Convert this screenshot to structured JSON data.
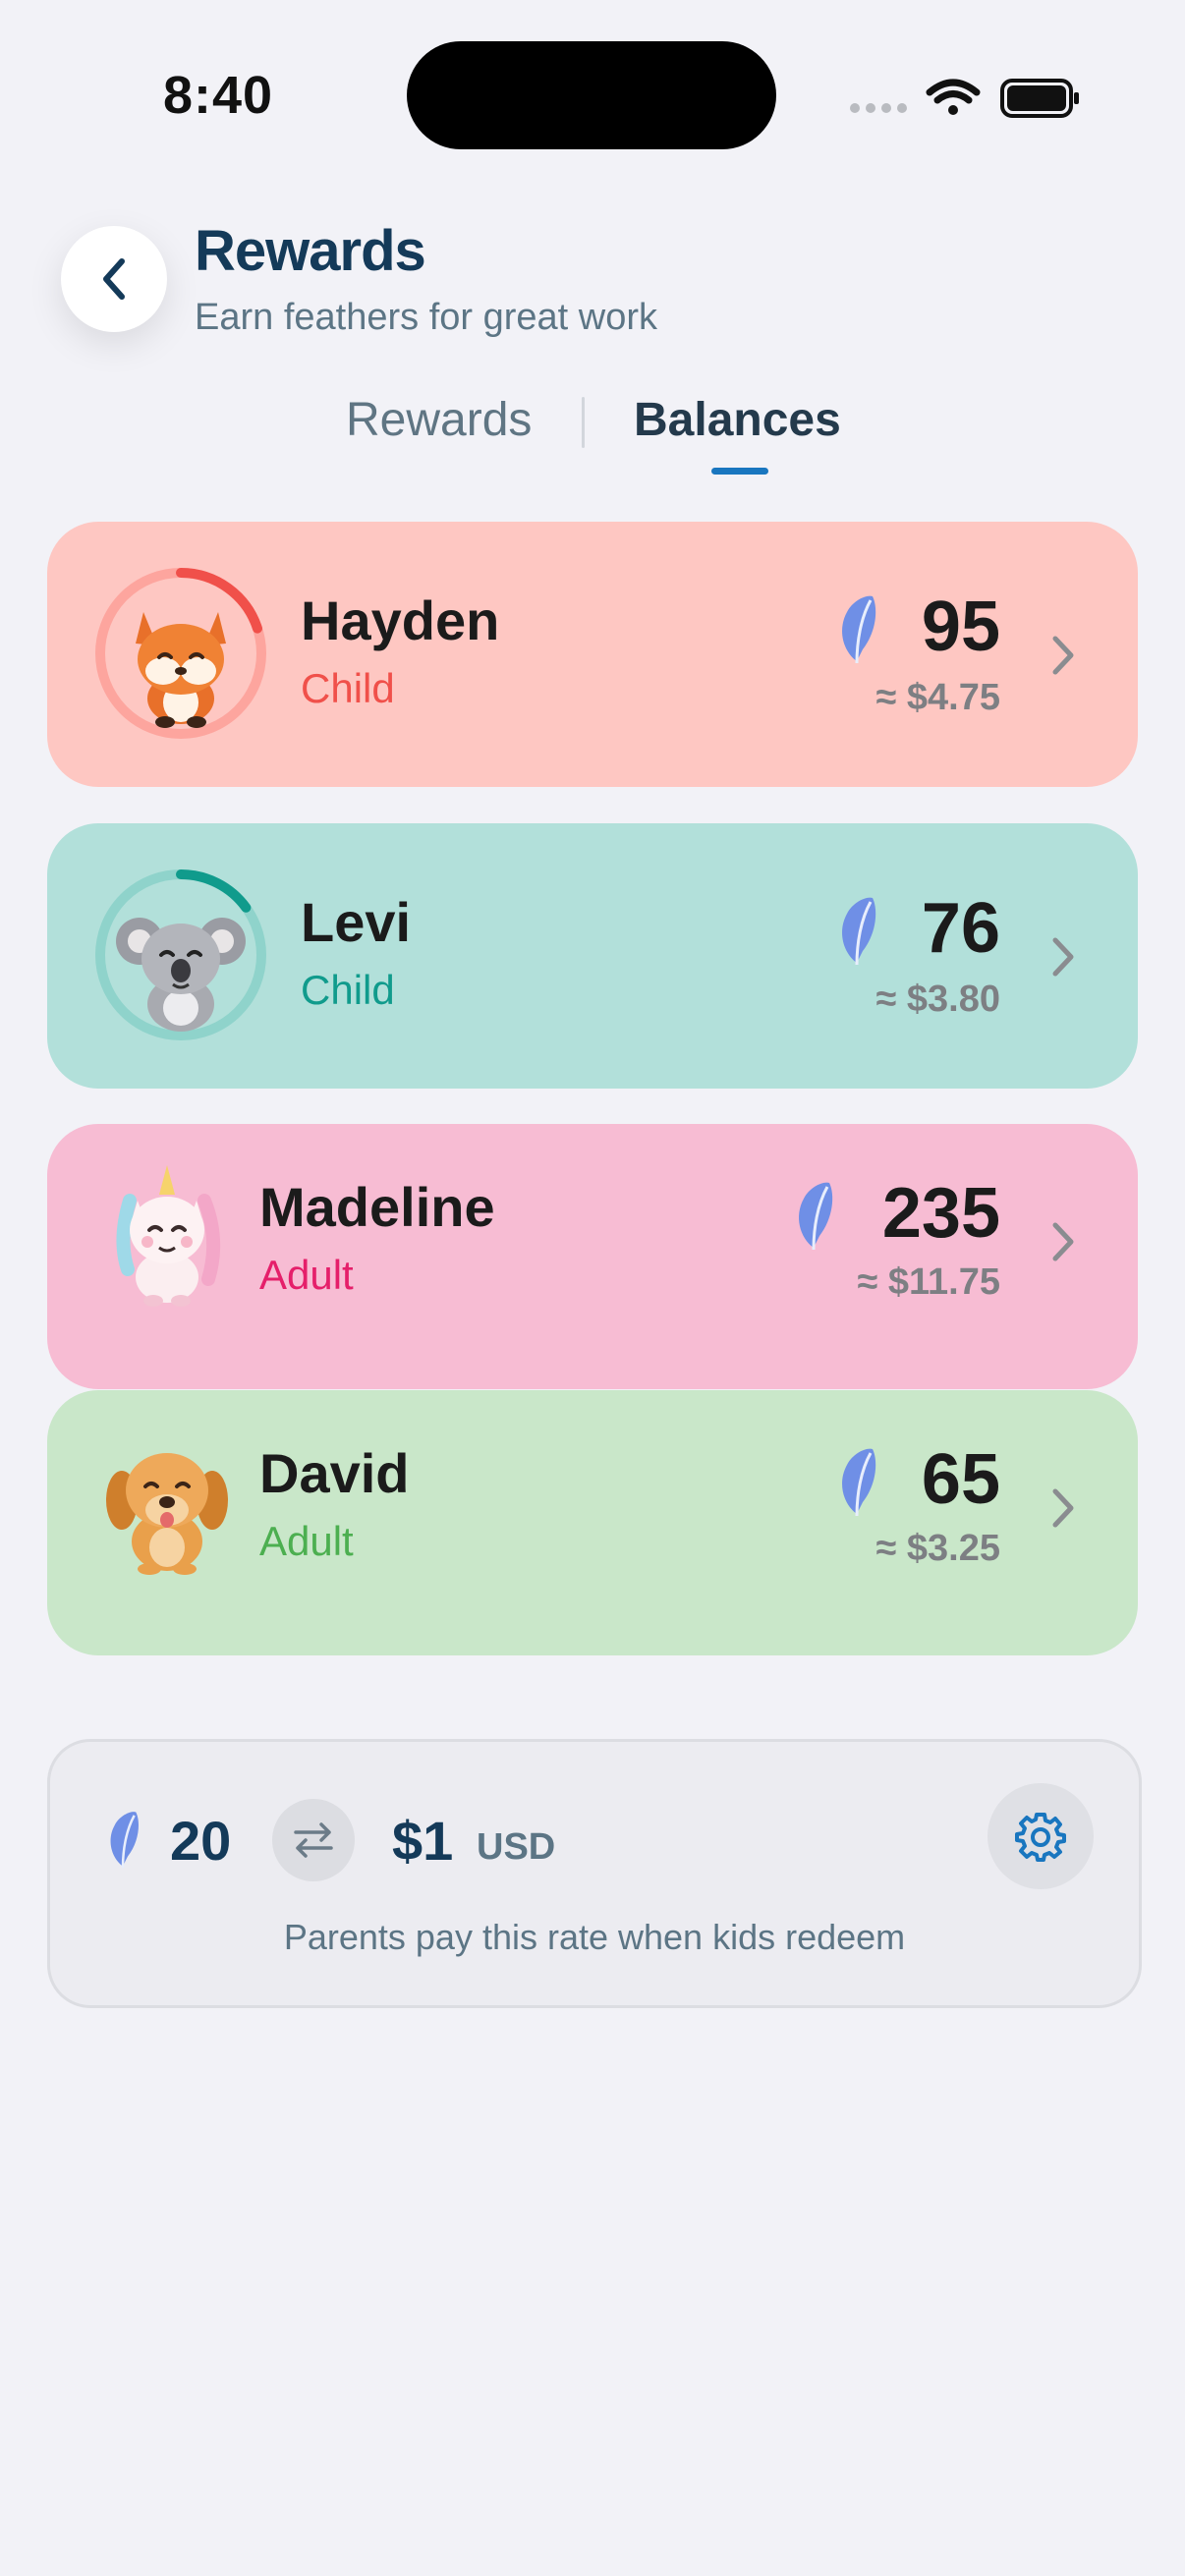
{
  "status_bar": {
    "time": "8:40",
    "icons": [
      "signal-icon",
      "wifi-icon",
      "battery-icon"
    ]
  },
  "header": {
    "back_icon": "chevron-left-icon",
    "title": "Rewards",
    "subtitle": "Earn feathers for great work"
  },
  "tabs": [
    {
      "label": "Rewards",
      "active": false
    },
    {
      "label": "Balances",
      "active": true
    }
  ],
  "members": [
    {
      "name": "Hayden",
      "role": "Child",
      "points": "95",
      "money": "≈ $4.75",
      "avatar": "fox-avatar",
      "role_color": "#f0504a",
      "ring_color": "#f0504a",
      "progress": 0.2
    },
    {
      "name": "Levi",
      "role": "Child",
      "points": "76",
      "money": "≈ $3.80",
      "avatar": "koala-avatar",
      "role_color": "#109b8c",
      "ring_color": "#109b8c",
      "progress": 0.15
    },
    {
      "name": "Madeline",
      "role": "Adult",
      "points": "235",
      "money": "≈ $11.75",
      "avatar": "unicorn-avatar",
      "role_color": "#e51f6a"
    },
    {
      "name": "David",
      "role": "Adult",
      "points": "65",
      "money": "≈ $3.25",
      "avatar": "puppy-avatar",
      "role_color": "#4caf50"
    }
  ],
  "conversion": {
    "points": "20",
    "money": "$1",
    "currency": "USD",
    "note": "Parents pay this rate when kids redeem",
    "icons": [
      "feather-icon",
      "swap-icon",
      "gear-icon"
    ]
  },
  "colors": {
    "accent": "#1976bf",
    "title": "#143a59",
    "feather": "#6f8fe6"
  }
}
